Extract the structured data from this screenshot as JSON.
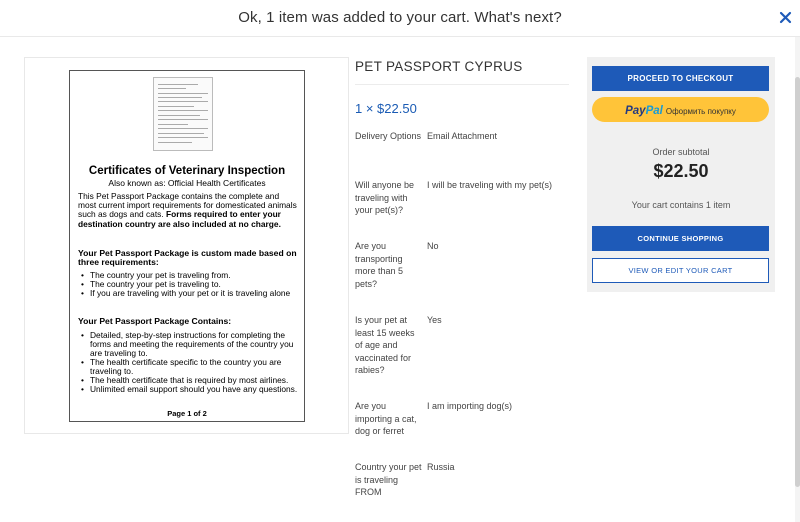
{
  "header": {
    "title": "Ok, 1 item was added to your cart. What's next?"
  },
  "product_document": {
    "heading": "Certificates of Veterinary Inspection",
    "subheading": "Also known as: Official Health Certificates",
    "intro": "This Pet Passport Package contains the complete and most current import requirements for domesticated animals such as dogs and cats.",
    "intro_bold": "Forms required to enter your destination country are also included at no charge.",
    "custom_heading": "Your Pet Passport Package is custom made based on three requirements:",
    "requirements": [
      "The country your pet is traveling from.",
      "The country your pet is traveling to.",
      "If you are traveling with your pet or it is traveling alone"
    ],
    "contains_heading": "Your Pet Passport Package Contains:",
    "contents": [
      "Detailed, step-by-step instructions for completing the forms and meeting the requirements of the country you are traveling to.",
      "The health certificate specific to the country you are traveling to.",
      "The health certificate that is required by most airlines.",
      "Unlimited email support should you have any questions."
    ],
    "page_label": "Page 1 of 2"
  },
  "product": {
    "title": "PET PASSPORT CYPRUS",
    "price_line": "1 × $22.50",
    "options": [
      {
        "label": "Delivery Options",
        "value": "Email Attachment"
      },
      {
        "label": "Will anyone be traveling with your pet(s)?",
        "value": "I will be traveling with my pet(s)"
      },
      {
        "label": "Are you transporting more than 5 pets?",
        "value": "No"
      },
      {
        "label": "Is your pet at least 15 weeks of age and vaccinated for rabies?",
        "value": "Yes"
      },
      {
        "label": "Are you importing a cat, dog or ferret",
        "value": "I am importing dog(s)"
      },
      {
        "label": "Country your pet is traveling FROM",
        "value": "Russia"
      }
    ]
  },
  "cart": {
    "checkout_label": "PROCEED TO CHECKOUT",
    "paypal_brand_1": "Pay",
    "paypal_brand_2": "Pal",
    "paypal_label": "Оформить покупку",
    "subtotal_label": "Order subtotal",
    "subtotal_value": "$22.50",
    "count_text": "Your cart contains 1 item",
    "continue_label": "CONTINUE SHOPPING",
    "view_label": "VIEW OR EDIT YOUR CART"
  },
  "colors": {
    "accent": "#1e5ab8",
    "paypal_yellow": "#ffc439",
    "price_blue": "#1a5bb4"
  },
  "icons": {
    "close": "close-icon"
  }
}
